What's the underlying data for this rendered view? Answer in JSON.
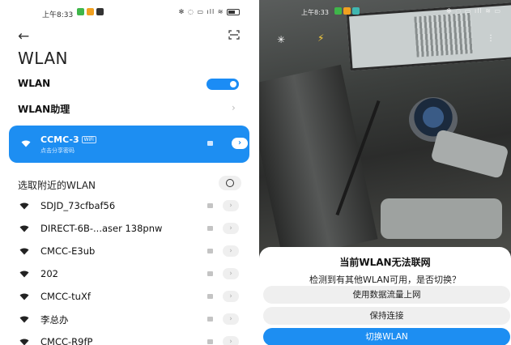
{
  "left": {
    "status_bar": {
      "time": "上午8:33",
      "right_text": "✻ ▣ ▤ ▥ ⌔"
    },
    "title": "WLAN",
    "wlan_toggle": {
      "label": "WLAN",
      "on": true
    },
    "wlan_helper": {
      "label": "WLAN助理"
    },
    "connected": {
      "ssid": "CCMC-3",
      "tag": "WiFi",
      "subtitle": "点击分享密码"
    },
    "nearby": {
      "title": "选取附近的WLAN",
      "networks": [
        {
          "name": "SDJD_73cfbaf56"
        },
        {
          "name": "DIRECT-6B-...aser 138pnw"
        },
        {
          "name": "CMCC-E3ub"
        },
        {
          "name": "202"
        },
        {
          "name": "CMCC-tuXf"
        },
        {
          "name": "李总办"
        },
        {
          "name": "CMCC-R9fP"
        }
      ]
    },
    "colors": {
      "accent": "#1d8ef2",
      "toggle": "#1b8cf5"
    }
  },
  "right": {
    "status_bar": {
      "time": "上午8:33"
    },
    "dialog": {
      "title": "当前WLAN无法联网",
      "message": "检测到有其他WLAN可用，是否切换？",
      "buttons": [
        {
          "label": "使用数据流量上网",
          "primary": false
        },
        {
          "label": "保持连接",
          "primary": false
        },
        {
          "label": "切换WLAN",
          "primary": true
        }
      ]
    }
  }
}
